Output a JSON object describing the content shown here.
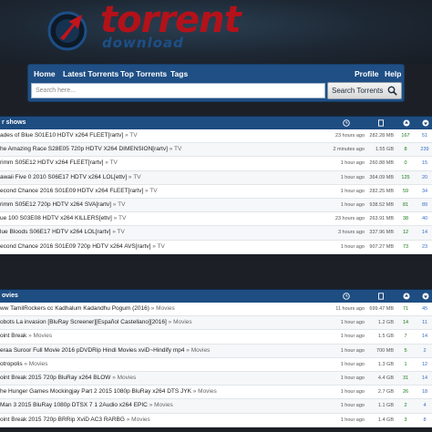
{
  "brand": {
    "title": "torrent",
    "subtitle": "download",
    "colors": {
      "title": "#b3121a",
      "subtitle": "#1d4f86",
      "nav": "#1f4f85"
    }
  },
  "nav": {
    "items": [
      "Home",
      "Latest Torrents",
      "Top Torrents",
      "Tags"
    ],
    "right_items": [
      "Profile",
      "Help"
    ]
  },
  "search": {
    "placeholder": "Search here...",
    "button_label": "Search Torrents"
  },
  "tv_panel": {
    "title": "r shows",
    "rows": [
      {
        "name": "ades of Blue S01E10 HDTV x264 FLEET[rartv]",
        "cat": "» TV",
        "added": "23 hours ago",
        "size": "282.28 MB",
        "seeds": "167",
        "leech": "51"
      },
      {
        "name": "he Amazing Race S28E05 720p HDTV X264 DIMENSION[rartv]",
        "cat": "» TV",
        "added": "2 minutes ago",
        "size": "1.55 GB",
        "seeds": "8",
        "leech": "239"
      },
      {
        "name": "rimm S05E12 HDTV x264 FLEET[rartv]",
        "cat": "» TV",
        "added": "1 hour ago",
        "size": "260.88 MB",
        "seeds": "0",
        "leech": "15"
      },
      {
        "name": "awaii Five 0 2010 S06E17 HDTV x264 LOL[ettv]",
        "cat": "» TV",
        "added": "1 hour ago",
        "size": "364.09 MB",
        "seeds": "125",
        "leech": "20"
      },
      {
        "name": "econd Chance 2016 S01E09 HDTV x264 FLEET[rartv]",
        "cat": "» TV",
        "added": "1 hour ago",
        "size": "282.25 MB",
        "seeds": "59",
        "leech": "34"
      },
      {
        "name": "rimm S05E12 720p HDTV x264 SVA[rartv]",
        "cat": "» TV",
        "added": "1 hour ago",
        "size": "938.52 MB",
        "seeds": "81",
        "leech": "89"
      },
      {
        "name": "ue 100 S03E08 HDTV x264 KILLERS[ettv]",
        "cat": "» TV",
        "added": "23 hours ago",
        "size": "263.91 MB",
        "seeds": "38",
        "leech": "40"
      },
      {
        "name": "lue Bloods S06E17 HDTV x264 LOL[rartv]",
        "cat": "» TV",
        "added": "3 hours ago",
        "size": "337.96 MB",
        "seeds": "12",
        "leech": "14"
      },
      {
        "name": "econd Chance 2016 S01E09 720p HDTV x264 AVS[rartv]",
        "cat": "» TV",
        "added": "1 hour ago",
        "size": "907.27 MB",
        "seeds": "73",
        "leech": "23"
      }
    ]
  },
  "movies_panel": {
    "title": "ovies",
    "rows": [
      {
        "name": "ww TamilRockers cc Kadhalum Kadandhu Pogum (2016)",
        "cat": "» Movies",
        "added": "11 hours ago",
        "size": "699.47 MB",
        "seeds": "71",
        "leech": "45"
      },
      {
        "name": "obots La invasion [BluRay Screener][Español Castellano][2016]",
        "cat": "» Movies",
        "added": "1 hour ago",
        "size": "1.2 GB",
        "seeds": "14",
        "leech": "11"
      },
      {
        "name": "oint Break",
        "cat": "» Movies",
        "added": "1 hour ago",
        "size": "1.5 GB",
        "seeds": "7",
        "leech": "14"
      },
      {
        "name": "eraa Suroor Full Movie 2016 pDVDRip Hindi Movies xviD~Hindify mp4",
        "cat": "» Movies",
        "added": "1 hour ago",
        "size": "700 MB",
        "seeds": "5",
        "leech": "2"
      },
      {
        "name": "otropolis",
        "cat": "» Movies",
        "added": "1 hour ago",
        "size": "1.3 GB",
        "seeds": "1",
        "leech": "12"
      },
      {
        "name": "oint Break 2015 720p BluRay x264 BLOW",
        "cat": "» Movies",
        "added": "1 hour ago",
        "size": "4.4 GB",
        "seeds": "31",
        "leech": "14"
      },
      {
        "name": "he Hunger Games Mockingjay Part 2 2015 1080p BluRay x264 DTS JYK",
        "cat": "» Movies",
        "added": "1 hour ago",
        "size": "2.7 GB",
        "seeds": "26",
        "leech": "18"
      },
      {
        "name": "Man 3 2015 BluRay 1080p DTSX 7 1 2Audio x264 EPIC",
        "cat": "» Movies",
        "added": "1 hour ago",
        "size": "1.1 GB",
        "seeds": "2",
        "leech": "4"
      },
      {
        "name": "oint Break 2015 720p BRRip XviD AC3 RARBG",
        "cat": "» Movies",
        "added": "1 hour ago",
        "size": "1.4 GB",
        "seeds": "3",
        "leech": "8"
      }
    ]
  }
}
